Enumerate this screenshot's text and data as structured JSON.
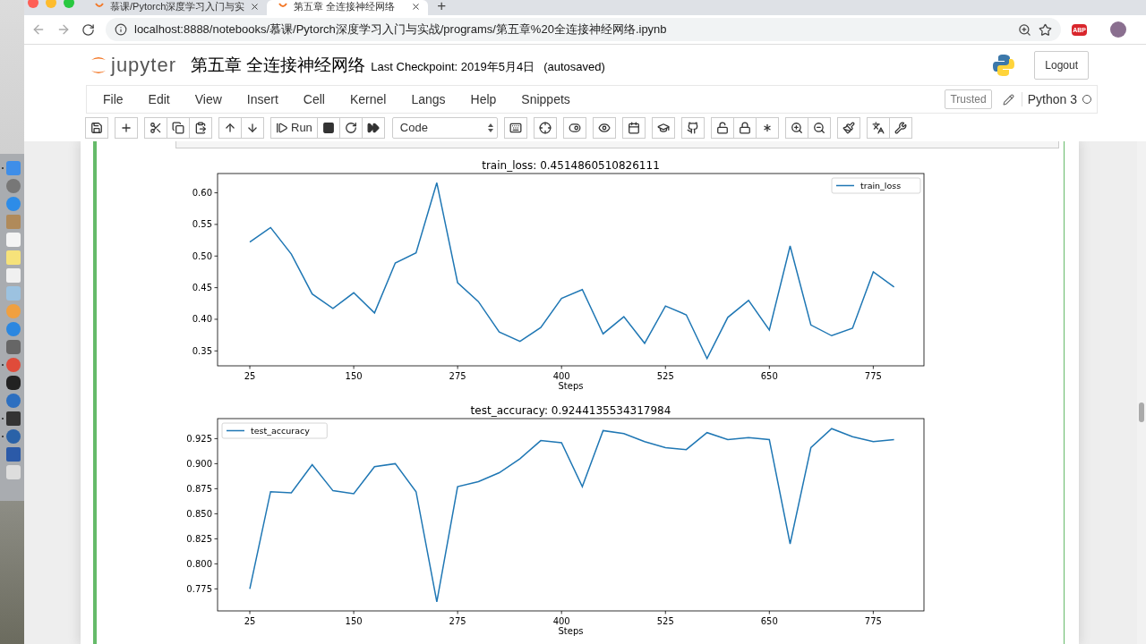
{
  "browser": {
    "tabs": [
      {
        "title": "慕课/Pytorch深度学习入门与实",
        "selected": false
      },
      {
        "title": "第五章 全连接神经网络",
        "selected": true
      }
    ],
    "new_tab": "+",
    "url": "localhost:8888/notebooks/慕课/Pytorch深度学习入门与实战/programs/第五章%20全连接神经网络.ipynb",
    "extension_badge": "ABP"
  },
  "header": {
    "logo_text": "jupyter",
    "notebook_title": "第五章 全连接神经网络",
    "checkpoint": "Last Checkpoint: 2019年5月4日",
    "autosave": "(autosaved)",
    "logout": "Logout"
  },
  "menu": [
    "File",
    "Edit",
    "View",
    "Insert",
    "Cell",
    "Kernel",
    "Langs",
    "Help",
    "Snippets"
  ],
  "trusted": "Trusted",
  "kernel_name": "Python 3",
  "kernel_busy": false,
  "toolbar": {
    "run_label": "Run",
    "cell_type": "Code"
  },
  "figures": [
    {
      "chart_data": {
        "type": "line",
        "title": "train_loss: 0.4514860510826111",
        "xlabel": "Steps",
        "x": [
          25,
          50,
          75,
          100,
          125,
          150,
          175,
          200,
          225,
          250,
          275,
          300,
          325,
          350,
          375,
          400,
          425,
          450,
          475,
          500,
          525,
          550,
          575,
          600,
          625,
          650,
          675,
          700,
          725,
          750,
          775,
          800
        ],
        "series": [
          {
            "name": "train_loss",
            "color": "#1f77b4",
            "values": [
              0.522,
              0.545,
              0.503,
              0.44,
              0.417,
              0.442,
              0.41,
              0.489,
              0.505,
              0.616,
              0.458,
              0.428,
              0.38,
              0.365,
              0.387,
              0.433,
              0.447,
              0.377,
              0.404,
              0.362,
              0.421,
              0.407,
              0.338,
              0.403,
              0.43,
              0.383,
              0.516,
              0.391,
              0.374,
              0.386,
              0.475,
              0.451
            ]
          }
        ],
        "xlim": [
          -13.8,
          836
        ],
        "ylim": [
          0.3264,
          0.6305
        ],
        "xticks": [
          25,
          150,
          275,
          400,
          525,
          650,
          775
        ],
        "yticks": [
          {
            "value": 0.35,
            "label": "0.35"
          },
          {
            "value": 0.4,
            "label": "0.40"
          },
          {
            "value": 0.45,
            "label": "0.45"
          },
          {
            "value": 0.5,
            "label": "0.50"
          },
          {
            "value": 0.55,
            "label": "0.55"
          },
          {
            "value": 0.6,
            "label": "0.60"
          }
        ]
      }
    },
    {
      "chart_data": {
        "type": "line",
        "title": "test_accuracy: 0.9244135534317984",
        "xlabel": "Steps",
        "x": [
          25,
          50,
          75,
          100,
          125,
          150,
          175,
          200,
          225,
          250,
          275,
          300,
          325,
          350,
          375,
          400,
          425,
          450,
          475,
          500,
          525,
          550,
          575,
          600,
          625,
          650,
          675,
          700,
          725,
          750,
          775,
          800
        ],
        "series": [
          {
            "name": "test_accuracy",
            "color": "#1f77b4",
            "values": [
              0.775,
              0.872,
              0.871,
              0.899,
              0.873,
              0.87,
              0.897,
              0.9,
              0.872,
              0.762,
              0.877,
              0.882,
              0.891,
              0.905,
              0.923,
              0.921,
              0.877,
              0.933,
              0.93,
              0.922,
              0.916,
              0.914,
              0.931,
              0.924,
              0.926,
              0.924,
              0.82,
              0.916,
              0.935,
              0.927,
              0.922,
              0.924
            ]
          }
        ],
        "xlim": [
          -13.8,
          836
        ],
        "ylim": [
          0.753,
          0.945
        ],
        "xticks": [
          25,
          150,
          275,
          400,
          525,
          650,
          775
        ],
        "yticks": [
          {
            "value": 0.775,
            "label": "0.775"
          },
          {
            "value": 0.8,
            "label": "0.800"
          },
          {
            "value": 0.825,
            "label": "0.825"
          },
          {
            "value": 0.85,
            "label": "0.850"
          },
          {
            "value": 0.875,
            "label": "0.875"
          },
          {
            "value": 0.9,
            "label": "0.900"
          },
          {
            "value": 0.925,
            "label": "0.925"
          }
        ]
      }
    }
  ]
}
